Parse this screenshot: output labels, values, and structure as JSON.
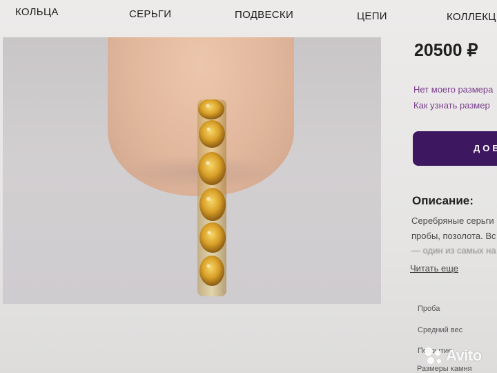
{
  "nav": {
    "items": [
      "КОЛЬЦА",
      "СЕРЬГИ",
      "ПОДВЕСКИ",
      "ЦЕПИ",
      "КОЛЛЕКЦ"
    ]
  },
  "product": {
    "price": "20500 ₽",
    "size_link": "Нет моего размера",
    "how_size_link": "Как узнать размер",
    "cart_button": "ДОБ"
  },
  "description": {
    "title": "Описание:",
    "lines": [
      "Серебряные серьги",
      "пробы, позолота. Вс",
      "— один из самых на"
    ],
    "read_more": "Читать еще"
  },
  "specs": {
    "labels": [
      "Проба",
      "Средний вес",
      "Покрытие",
      "Размеры камня"
    ]
  },
  "watermark": {
    "text": "Avito"
  },
  "colors": {
    "accent_button": "#3d1860",
    "link": "#7a3e8c",
    "stone": "#d9a028"
  }
}
